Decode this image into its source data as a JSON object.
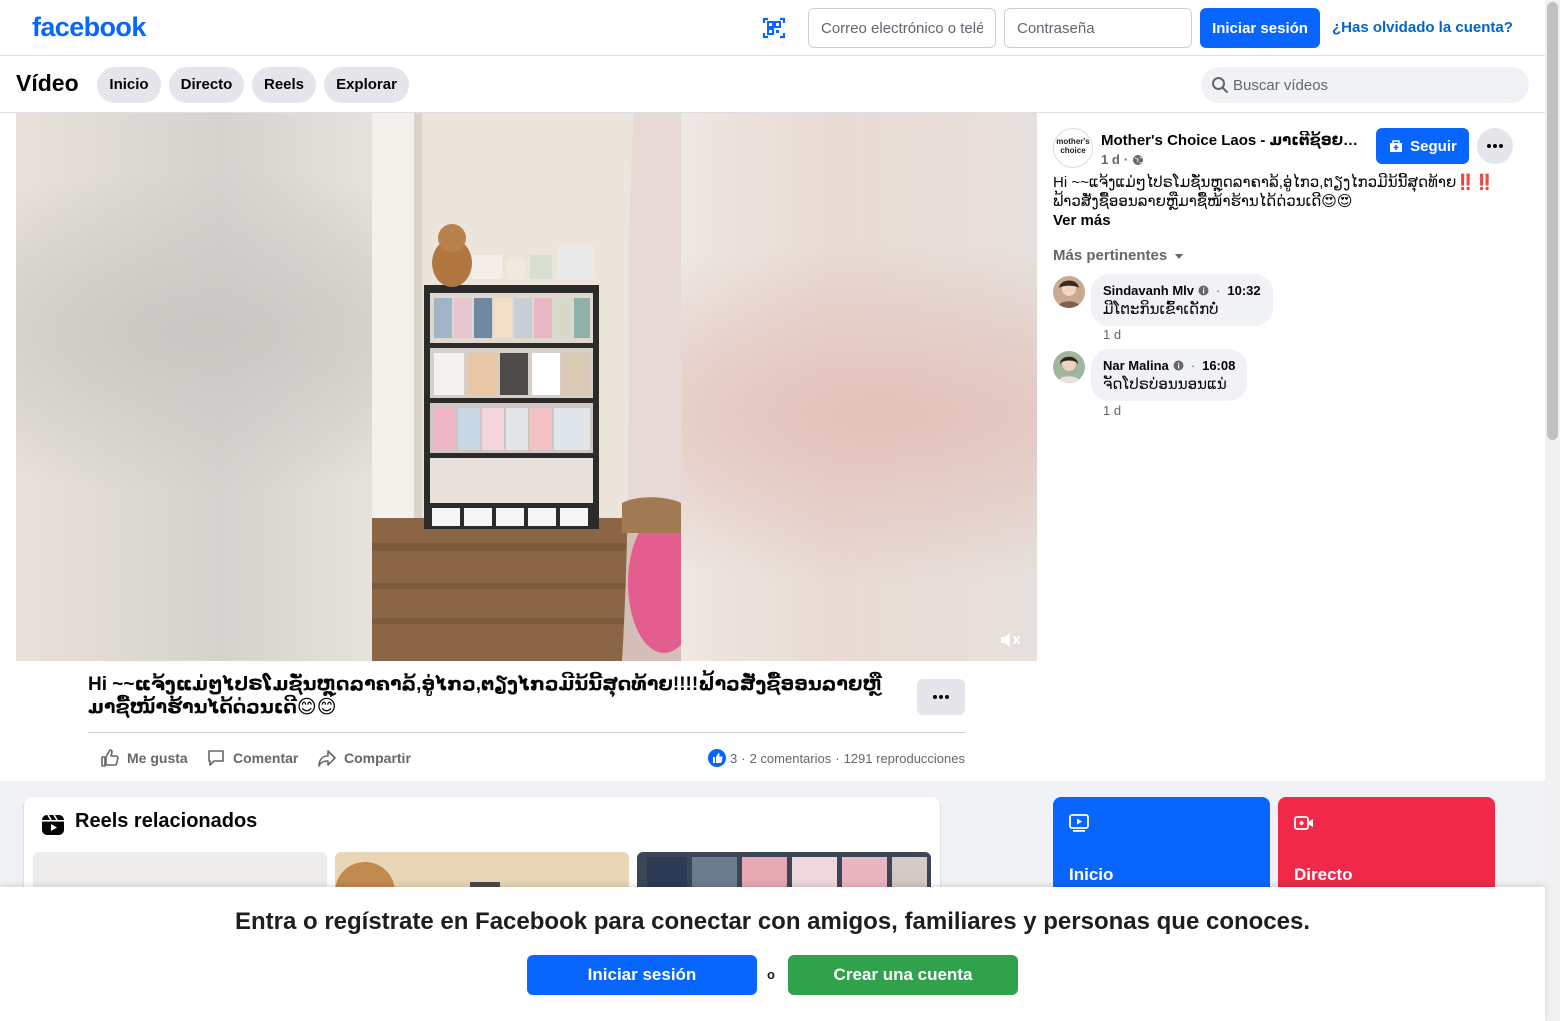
{
  "topbar": {
    "logo": "facebook",
    "email_placeholder": "Correo electrónico o teléfono",
    "password_placeholder": "Contraseña",
    "login_label": "Iniciar sesión",
    "forgot_label": "¿Has olvidado la cuenta?",
    "icons": {
      "scan": "qr-scan-icon"
    }
  },
  "videobar": {
    "title": "Vídeo",
    "tabs": [
      {
        "label": "Inicio"
      },
      {
        "label": "Directo"
      },
      {
        "label": "Reels"
      },
      {
        "label": "Explorar"
      }
    ],
    "search_placeholder": "Buscar vídeos"
  },
  "video": {
    "caption": "Hi ~~ແຈ້ງແມ່ໆໄປຣໂມຊັ່ນຫຼຸດລາຄາລ້,ອູ່ໄກວ,ຕຽງໄກວມີນ້ນີ້ສຸດທ້າຍ!!!!ຟ້າວສັ່ງຊື້ອອນລາຍຫຼືມາຊື້ໜ້າຮ້ານໄດ້ດ່ວນເດີ😊😊",
    "actions": {
      "like": "Me gusta",
      "comment": "Comentar",
      "share": "Compartir"
    },
    "stats": {
      "reactions": "3",
      "comments": "2 comentarios",
      "views": "1291 reproducciones"
    }
  },
  "post": {
    "page_name": "Mother's Choice Laos - ມາເຕີຊ້ອຍລາວ",
    "avatar_text": "mother's choice",
    "time": "1 d",
    "follow_label": "Seguir",
    "text": "Hi ~~ແຈ້ງແມ່ໆໄປຣໂມຊັ່ນຫຼຸດລາຄາລ້,ອູ່ໄກວ,ຕຽງໄກວມີນ້ນີ້ສຸດທ້າຍ‼️‼️ ຟ້າວສັ່ງຊື້ອອນລາຍຫຼືມາຊື້ໜ້າຮ້ານໄດ້ດ່ວນເດີ😍😍",
    "see_more": "Ver más",
    "sort_label": "Más pertinentes",
    "comments": [
      {
        "author": "Sindavanh Mlv",
        "time": "10:32",
        "text": "ມີໂຕະກິນເຂົ້າເດັກບໍ່",
        "age": "1 d"
      },
      {
        "author": "Nar Malina",
        "time": "16:08",
        "text": "ຈັດໂປຣບ່ອນນອນແນ່",
        "age": "1 d"
      }
    ]
  },
  "related": {
    "title": "Reels relacionados"
  },
  "tiles": [
    {
      "label": "Inicio",
      "color": "#0866ff"
    },
    {
      "label": "Directo",
      "color": "#f02849"
    }
  ],
  "overlay": {
    "text": "Entra o regístrate en Facebook para conectar con amigos, familiares y personas que conoces.",
    "login_label": "Iniciar sesión",
    "or": "o",
    "create_label": "Crear una cuenta"
  },
  "colors": {
    "brand": "#0866ff",
    "green": "#31a24c",
    "live": "#f02849"
  }
}
